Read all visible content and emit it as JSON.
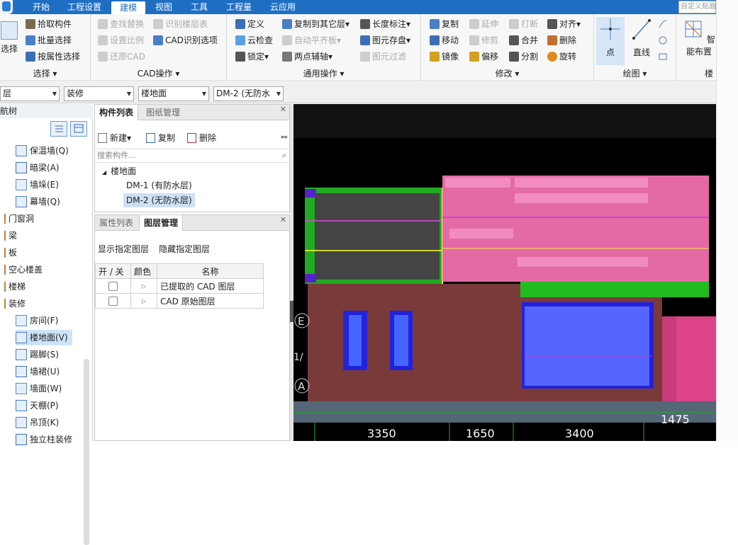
{
  "menu": {
    "tabs": [
      "开始",
      "工程设置",
      "建模",
      "视图",
      "工具",
      "工程量",
      "云应用"
    ],
    "active": "建模",
    "hint_placeholder": "自定义贴面"
  },
  "ribbon": {
    "select_group": {
      "label": "选择",
      "big_button": "选择",
      "items": [
        "拾取构件",
        "批量选择",
        "按属性选择"
      ]
    },
    "cad_group": {
      "label": "CAD操作",
      "items": [
        "查找替换",
        "识别楼层表",
        "设置比例",
        "CAD识别选项",
        "还原CAD"
      ]
    },
    "common_group": {
      "label": "通用操作",
      "items": [
        "定义",
        "复制到其它层",
        "长度标注",
        "云检查",
        "自动平齐板",
        "图元存盘",
        "锁定",
        "两点辅轴",
        "图元过滤"
      ]
    },
    "modify_group": {
      "label": "修改",
      "items": [
        "复制",
        "延伸",
        "打断",
        "对齐",
        "移动",
        "修剪",
        "合并",
        "删除",
        "镜像",
        "偏移",
        "分割",
        "旋转"
      ]
    },
    "draw_group": {
      "label": "绘图",
      "point": "点",
      "line": "直线"
    },
    "smart_group": {
      "label": "楼",
      "big_button": "智能布置"
    }
  },
  "filters": {
    "floor": "层",
    "category": "装修",
    "type": "楼地面",
    "component": "DM-2 (无防水"
  },
  "left_nav": {
    "title": "导航树",
    "items": [
      {
        "label": "保温墙(Q)",
        "indent": 1
      },
      {
        "label": "暗梁(A)",
        "indent": 1
      },
      {
        "label": "墙垛(E)",
        "indent": 1
      },
      {
        "label": "幕墙(Q)",
        "indent": 1
      },
      {
        "label": "门窗洞",
        "indent": 0
      },
      {
        "label": "梁",
        "indent": 0
      },
      {
        "label": "板",
        "indent": 0
      },
      {
        "label": "空心楼盖",
        "indent": 0
      },
      {
        "label": "楼梯",
        "indent": 0
      },
      {
        "label": "装修",
        "indent": 0
      },
      {
        "label": "房间(F)",
        "indent": 1
      },
      {
        "label": "楼地面(V)",
        "indent": 1,
        "selected": true
      },
      {
        "label": "踢脚(S)",
        "indent": 1
      },
      {
        "label": "墙裙(U)",
        "indent": 1
      },
      {
        "label": "墙面(W)",
        "indent": 1
      },
      {
        "label": "天棚(P)",
        "indent": 1
      },
      {
        "label": "吊顶(K)",
        "indent": 1
      },
      {
        "label": "独立柱装修",
        "indent": 1
      }
    ]
  },
  "component_panel": {
    "tabs": [
      "构件列表",
      "图纸管理"
    ],
    "toolbar": {
      "new": "新建",
      "copy": "复制",
      "delete": "删除"
    },
    "search_placeholder": "搜索构件...",
    "tree": {
      "root": "楼地面",
      "children": [
        "DM-1 (有防水层)",
        "DM-2 (无防水层)"
      ],
      "selected": "DM-2 (无防水层)"
    }
  },
  "layer_panel": {
    "tabs": [
      "属性列表",
      "图层管理"
    ],
    "show_btn": "显示指定图层",
    "hide_btn": "隐藏指定图层",
    "columns": [
      "开 / 关",
      "颜色",
      "名称"
    ],
    "rows": [
      {
        "name": "已提取的 CAD 图层"
      },
      {
        "name": "CAD 原始图层"
      }
    ]
  },
  "canvas": {
    "dimensions": [
      "3350",
      "1650",
      "3400",
      "1475"
    ],
    "axis_labels": [
      "E",
      "1/",
      "A"
    ]
  }
}
